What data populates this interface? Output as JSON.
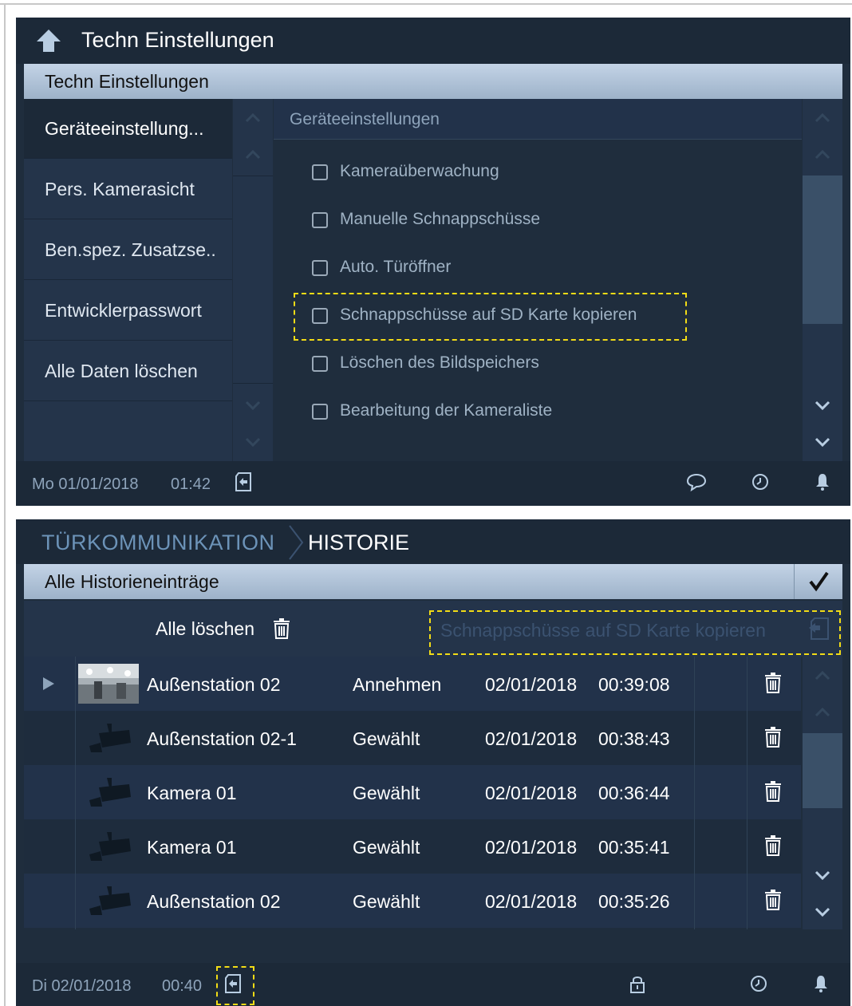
{
  "screen1": {
    "title": "Techn Einstellungen",
    "section_header": "Techn Einstellungen",
    "nav_items": [
      {
        "label": "Geräteeinstellung...",
        "active": true
      },
      {
        "label": "Pers. Kamerasicht",
        "active": false
      },
      {
        "label": "Ben.spez. Zusatzse..",
        "active": false
      },
      {
        "label": "Entwicklerpasswort",
        "active": false
      },
      {
        "label": "Alle Daten löschen",
        "active": false
      }
    ],
    "content_header": "Geräteeinstellungen",
    "options": [
      {
        "label": "Kameraüberwachung",
        "checked": false
      },
      {
        "label": "Manuelle Schnappschüsse",
        "checked": false
      },
      {
        "label": "Auto. Türöffner",
        "checked": false
      },
      {
        "label": "Schnappschüsse auf SD Karte kopieren",
        "checked": false,
        "highlighted": true
      },
      {
        "label": "Löschen des Bildspeichers",
        "checked": false
      },
      {
        "label": "Bearbeitung der Kameraliste",
        "checked": false
      }
    ],
    "status": {
      "date": "Mo 01/01/2018",
      "time": "01:42"
    }
  },
  "screen2": {
    "breadcrumb": {
      "parent": "TÜRKOMMUNIKATION",
      "current": "HISTORIE"
    },
    "section_header": "Alle Historieneinträge",
    "confirm_icon": "checkmark-icon",
    "delete_all_label": "Alle löschen",
    "copy_to_sd_label": "Schnappschüsse auf SD Karte kopieren",
    "columns": [
      "name",
      "action",
      "date",
      "time"
    ],
    "entries": [
      {
        "name": "Außenstation 02",
        "action": "Annehmen",
        "date": "02/01/2018",
        "time": "00:39:08",
        "has_snapshot": true
      },
      {
        "name": "Außenstation 02-1",
        "action": "Gewählt",
        "date": "02/01/2018",
        "time": "00:38:43",
        "has_snapshot": false
      },
      {
        "name": "Kamera 01",
        "action": "Gewählt",
        "date": "02/01/2018",
        "time": "00:36:44",
        "has_snapshot": false
      },
      {
        "name": "Kamera 01",
        "action": "Gewählt",
        "date": "02/01/2018",
        "time": "00:35:41",
        "has_snapshot": false
      },
      {
        "name": "Außenstation 02",
        "action": "Gewählt",
        "date": "02/01/2018",
        "time": "00:35:26",
        "has_snapshot": false
      }
    ],
    "status": {
      "date": "Di 02/01/2018",
      "time": "00:40"
    }
  },
  "colors": {
    "panel_bg": "#1f2d3d",
    "header_gradient_top": "#c3d3e6",
    "highlight_dash": "#f2dc16",
    "text_muted": "#8ea4bb"
  }
}
